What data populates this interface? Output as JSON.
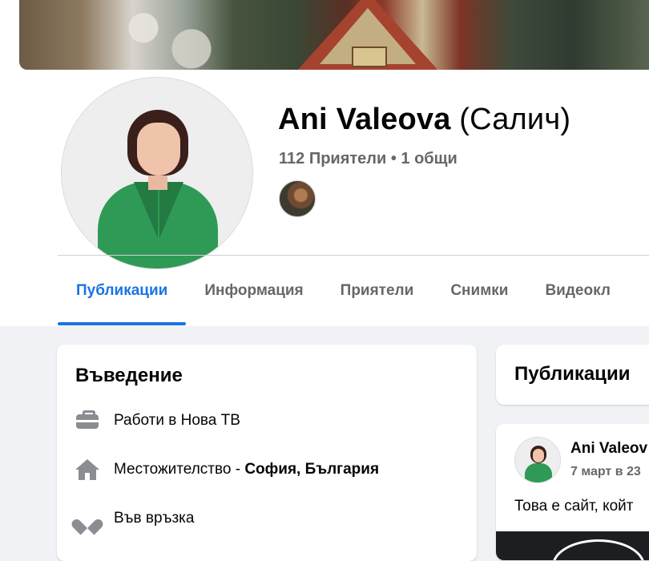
{
  "profile": {
    "name": "Ani Valeova",
    "alternate_name": "(Салич)",
    "friends_line": "112 Приятели • 1 общи"
  },
  "tabs": [
    {
      "label": "Публикации",
      "active": true
    },
    {
      "label": "Информация",
      "active": false
    },
    {
      "label": "Приятели",
      "active": false
    },
    {
      "label": "Снимки",
      "active": false
    },
    {
      "label": "Видеокл",
      "active": false
    }
  ],
  "intro": {
    "title": "Въведение",
    "items": [
      {
        "icon": "briefcase-icon",
        "text": "Работи в Нова ТВ"
      },
      {
        "icon": "home-icon",
        "prefix": "Местожителство - ",
        "value": "София, България"
      },
      {
        "icon": "heart-icon",
        "text": "Във връзка"
      }
    ]
  },
  "posts": {
    "title": "Публикации",
    "first_post": {
      "author": "Ani Valeov",
      "time": "7 март в 23",
      "text": "Това е сайт, койт"
    }
  },
  "colors": {
    "accent": "#1b74e4",
    "secondary_text": "#65676b",
    "background": "#f0f2f5",
    "icon_gray": "#8a8d91"
  }
}
